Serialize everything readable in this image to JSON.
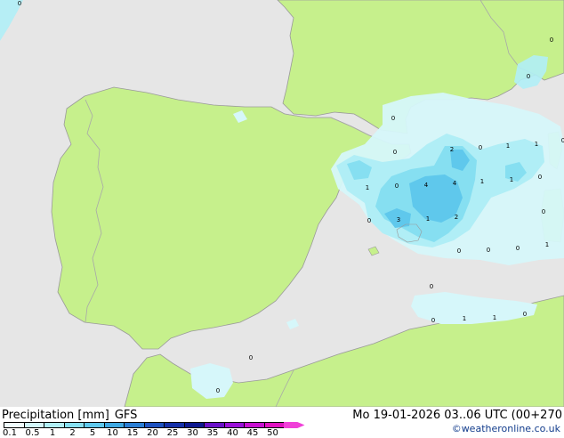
{
  "map": {
    "colors": {
      "sea": "#e6e6e6",
      "land": "#c6f08c",
      "coast": "#9a9a9a",
      "border": "#a8a8a8",
      "precip_0_1": "#d6f7fa",
      "precip_0_5": "#b0eef6",
      "precip_1": "#86dff1",
      "precip_2": "#5fc8ec"
    },
    "point_values": [
      {
        "id": "pv-1",
        "value": "0"
      },
      {
        "id": "pv-2",
        "value": "0"
      },
      {
        "id": "pv-3",
        "value": "0"
      },
      {
        "id": "pv-4",
        "value": "0"
      },
      {
        "id": "pv-5",
        "value": "0"
      },
      {
        "id": "pv-6",
        "value": "2"
      },
      {
        "id": "pv-7",
        "value": "0"
      },
      {
        "id": "pv-8",
        "value": "1"
      },
      {
        "id": "pv-9",
        "value": "1"
      },
      {
        "id": "pv-10",
        "value": "1"
      },
      {
        "id": "pv-11",
        "value": "0"
      },
      {
        "id": "pv-12",
        "value": "4"
      },
      {
        "id": "pv-13",
        "value": "4"
      },
      {
        "id": "pv-14",
        "value": "1"
      },
      {
        "id": "pv-15",
        "value": "1"
      },
      {
        "id": "pv-16",
        "value": "0"
      },
      {
        "id": "pv-17",
        "value": "0"
      },
      {
        "id": "pv-18",
        "value": "3"
      },
      {
        "id": "pv-19",
        "value": "1"
      },
      {
        "id": "pv-20",
        "value": "2"
      },
      {
        "id": "pv-21",
        "value": "0"
      },
      {
        "id": "pv-22",
        "value": "0"
      },
      {
        "id": "pv-23",
        "value": "0"
      },
      {
        "id": "pv-24",
        "value": "0"
      },
      {
        "id": "pv-25",
        "value": "1"
      },
      {
        "id": "pv-26",
        "value": "0"
      },
      {
        "id": "pv-27",
        "value": "0"
      },
      {
        "id": "pv-28",
        "value": "1"
      },
      {
        "id": "pv-29",
        "value": "1"
      },
      {
        "id": "pv-30",
        "value": "0"
      },
      {
        "id": "pv-31",
        "value": "0"
      },
      {
        "id": "pv-32",
        "value": "0"
      },
      {
        "id": "pv-33",
        "value": "0"
      }
    ]
  },
  "legend": {
    "title": "Precipitation [mm]",
    "model": "GFS",
    "swatches": [
      {
        "color": "#eefcfd"
      },
      {
        "color": "#d2f6fa"
      },
      {
        "color": "#b0eef6"
      },
      {
        "color": "#86dff1"
      },
      {
        "color": "#5fc8ec"
      },
      {
        "color": "#3ea8e2"
      },
      {
        "color": "#2a7ed4"
      },
      {
        "color": "#1e52c0"
      },
      {
        "color": "#1530a8"
      },
      {
        "color": "#0d1890"
      },
      {
        "color": "#6a10c8"
      },
      {
        "color": "#9a10d8"
      },
      {
        "color": "#c810d0"
      },
      {
        "color": "#e010c0"
      },
      {
        "color": "#f040d8"
      }
    ],
    "ticks": [
      "0.1",
      "0.5",
      "1",
      "2",
      "5",
      "10",
      "15",
      "20",
      "25",
      "30",
      "35",
      "40",
      "45",
      "50"
    ]
  },
  "datetime": "Mo 19-01-2026 03..06 UTC (00+270",
  "credit": "©weatheronline.co.uk"
}
